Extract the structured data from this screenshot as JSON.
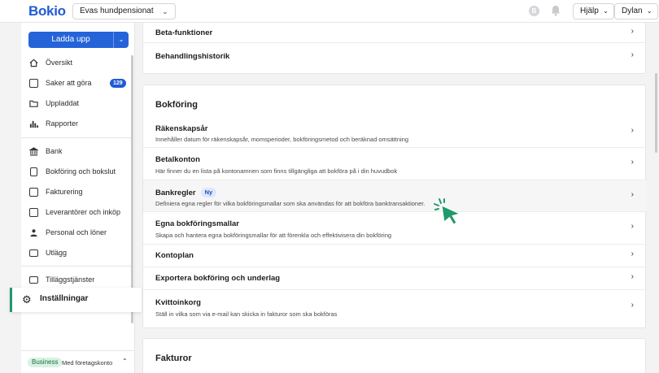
{
  "header": {
    "logo": "Bokio",
    "company": "Evas hundpensionat",
    "help": "Hjälp",
    "user": "Dylan"
  },
  "sidebar": {
    "upload_label": "Ladda upp",
    "items": [
      {
        "label": "Översikt",
        "icon": "home-icon"
      },
      {
        "label": "Saker att göra",
        "icon": "todo-icon",
        "badge": "129"
      },
      {
        "label": "Uppladdat",
        "icon": "folder-icon"
      },
      {
        "label": "Rapporter",
        "icon": "chart-icon"
      },
      {
        "label": "Bank",
        "icon": "bank-icon"
      },
      {
        "label": "Bokföring och bokslut",
        "icon": "ledger-icon"
      },
      {
        "label": "Fakturering",
        "icon": "invoice-icon"
      },
      {
        "label": "Leverantörer och inköp",
        "icon": "supplier-icon"
      },
      {
        "label": "Personal och löner",
        "icon": "person-icon"
      },
      {
        "label": "Utlägg",
        "icon": "card-icon"
      },
      {
        "label": "Tilläggstjänster",
        "icon": "addon-icon"
      }
    ],
    "settings_label": "Inställningar",
    "plan_badge": "Business",
    "plan_sub": "Med företagskonto"
  },
  "main": {
    "top_rows": [
      {
        "title": "Beta-funktioner"
      },
      {
        "title": "Behandlingshistorik"
      }
    ],
    "bokforing": {
      "title": "Bokföring",
      "rows": [
        {
          "title": "Räkenskapsår",
          "desc": "Innehåller datum för räkenskapsår, momsperioder, bokföringsmetod och beräknad omsättning"
        },
        {
          "title": "Betalkonton",
          "desc": "Här finner du en lista på kontonamnen som finns tillgängliga att bokföra på i din huvudbok"
        },
        {
          "title": "Bankregler",
          "badge": "Ny",
          "desc": "Definiera egna regler för vilka bokföringsmallar som ska användas för att bokföra banktransaktioner."
        },
        {
          "title": "Egna bokföringsmallar",
          "desc": "Skapa och hantera egna bokföringsmallar för att förenkla och effektivisera din bokföring"
        },
        {
          "title": "Kontoplan"
        },
        {
          "title": "Exportera bokföring och underlag"
        },
        {
          "title": "Kvittoinkorg",
          "desc": "Ställ in vilka som via e-mail kan skicka in fakturor som ska bokföras"
        }
      ]
    },
    "fakturor": {
      "title": "Fakturor"
    }
  },
  "colors": {
    "brand": "#1f5bd6",
    "accent_green": "#1f9a6c",
    "cursor": "#1f9a6c"
  }
}
